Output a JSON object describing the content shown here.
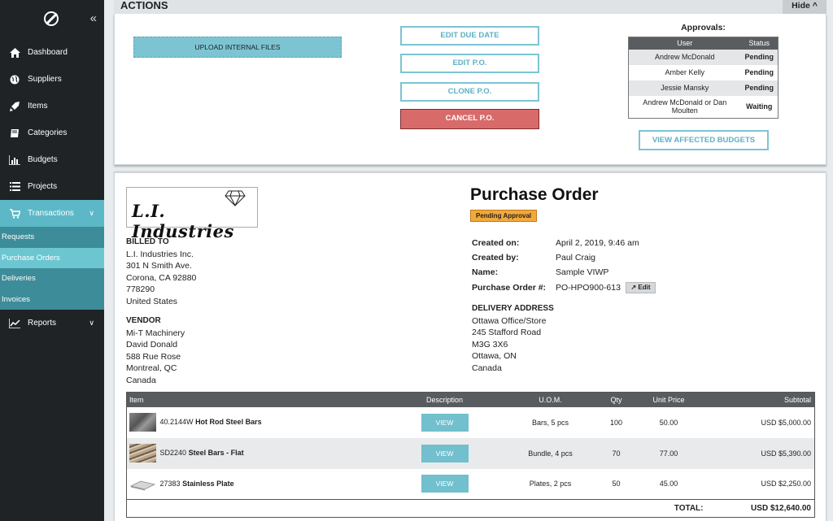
{
  "sidebar": {
    "items": [
      {
        "label": "Dashboard",
        "icon": "home-icon"
      },
      {
        "label": "Suppliers",
        "icon": "globe-icon"
      },
      {
        "label": "Items",
        "icon": "rocket-icon"
      },
      {
        "label": "Categories",
        "icon": "book-icon"
      },
      {
        "label": "Budgets",
        "icon": "bar-chart-icon"
      },
      {
        "label": "Projects",
        "icon": "list-icon"
      },
      {
        "label": "Transactions",
        "icon": "cart-icon"
      }
    ],
    "sub_items": [
      "Requests",
      "Purchase Orders",
      "Deliveries",
      "Invoices"
    ],
    "reports_label": "Reports"
  },
  "actions": {
    "title": "ACTIONS",
    "hide_label": "Hide ^",
    "upload_label": "UPLOAD INTERNAL FILES",
    "edit_due_date": "EDIT DUE DATE",
    "edit_po": "EDIT P.O.",
    "clone_po": "CLONE P.O.",
    "cancel_po": "CANCEL P.O.",
    "approvals_title": "Approvals:",
    "approvals_headers": [
      "User",
      "Status"
    ],
    "approvals": [
      {
        "user": "Andrew McDonald",
        "status": "Pending"
      },
      {
        "user": "Amber Kelly",
        "status": "Pending"
      },
      {
        "user": "Jessie Mansky",
        "status": "Pending"
      },
      {
        "user": "Andrew McDonald or Dan Moulten",
        "status": "Waiting"
      }
    ],
    "view_budgets": "VIEW AFFECTED BUDGETS"
  },
  "po": {
    "logo_text": "L.I. Industries",
    "title": "Purchase Order",
    "badge": "Pending Approval",
    "billed_to_heading": "BILLED TO",
    "billed_to": [
      "L.I. Industries Inc.",
      "301 N Smith Ave.",
      "Corona, CA 92880",
      "778290",
      "United States"
    ],
    "vendor_heading": "VENDOR",
    "vendor": [
      "Mi-T Machinery",
      "David Donald",
      "588 Rue Rose",
      "Montreal, QC",
      "Canada"
    ],
    "meta": {
      "created_on_label": "Created on:",
      "created_on": "April 2, 2019, 9:46 am",
      "created_by_label": "Created by:",
      "created_by": "Paul Craig",
      "name_label": "Name:",
      "name": "Sample VIWP",
      "po_number_label": "Purchase Order #:",
      "po_number": "PO-HPO900-613",
      "edit_label": "Edit"
    },
    "delivery_heading": "DELIVERY ADDRESS",
    "delivery": [
      "Ottawa Office/Store",
      "245 Stafford Road",
      "M3G 3X6",
      "Ottawa, ON",
      "Canada"
    ],
    "table_headers": [
      "Item",
      "Description",
      "U.O.M.",
      "Qty",
      "Unit Price",
      "Subtotal"
    ],
    "rows": [
      {
        "code": "40.2144W",
        "name": "Hot Rod Steel Bars",
        "view": "VIEW",
        "uom": "Bars, 5 pcs",
        "qty": "100",
        "price": "50.00",
        "subtotal": "USD $5,000.00"
      },
      {
        "code": "SD2240",
        "name": "Steel Bars - Flat",
        "view": "VIEW",
        "uom": "Bundle, 4 pcs",
        "qty": "70",
        "price": "77.00",
        "subtotal": "USD $5,390.00"
      },
      {
        "code": "27383",
        "name": "Stainless Plate",
        "view": "VIEW",
        "uom": "Plates, 2 pcs",
        "qty": "50",
        "price": "45.00",
        "subtotal": "USD $2,250.00"
      }
    ],
    "total_label": "TOTAL:",
    "total": "USD $12,640.00"
  }
}
